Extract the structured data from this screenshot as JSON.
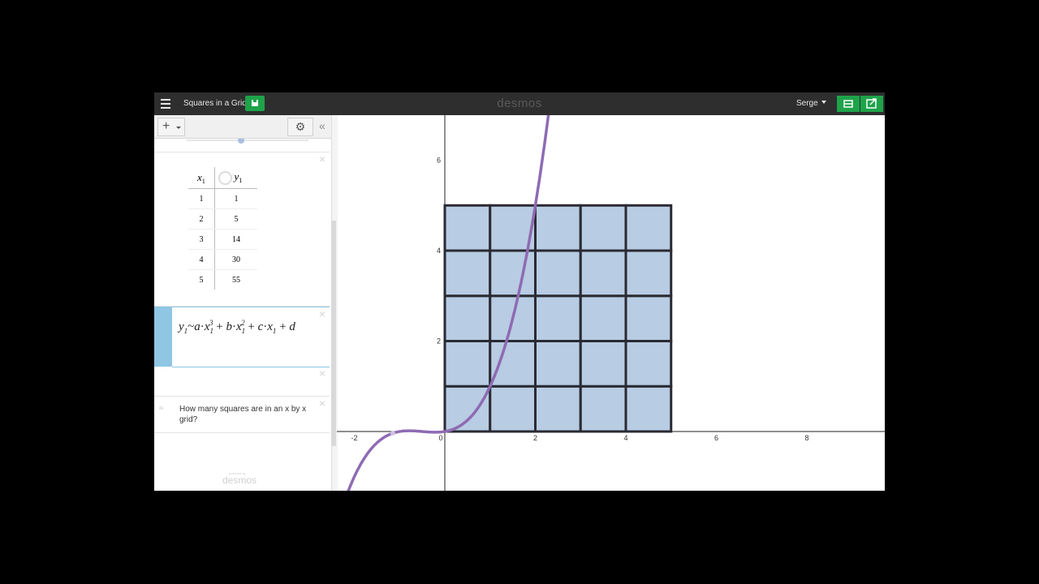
{
  "app": {
    "title": "Squares in a Grid",
    "brand": "desmos",
    "user": "Serge",
    "powered_by": "powered by",
    "powered_brand": "desmos"
  },
  "panel": {
    "add_label": "+",
    "gear": "⚙",
    "collapse": "«",
    "table": {
      "headers": [
        "x",
        "y"
      ],
      "subscript": "1",
      "rows": [
        [
          "1",
          "1"
        ],
        [
          "2",
          "5"
        ],
        [
          "3",
          "14"
        ],
        [
          "4",
          "30"
        ],
        [
          "5",
          "55"
        ]
      ]
    },
    "regression": {
      "y": "y",
      "sub": "1",
      "tilde": "~",
      "a": "a",
      "x": "x",
      "p3": "3",
      "plus": "+",
      "b": "b",
      "p2": "2",
      "c": "c",
      "d": "d"
    },
    "note_text": "How many squares are in an x by x grid?",
    "note_quote": "“"
  },
  "graph": {
    "x_ticks": [
      "-2",
      "0",
      "2",
      "4",
      "6",
      "8"
    ],
    "y_ticks": [
      "2",
      "4",
      "6"
    ],
    "curve_color": "#8e6bb3",
    "square_fill": "#b8cce3",
    "square_stroke": "#2a2a33",
    "grid_size": 5
  },
  "colors": {
    "accent_green": "#1ea34a",
    "header_bg": "#2e2e2e",
    "selected_expr": "#8ec6e4"
  }
}
